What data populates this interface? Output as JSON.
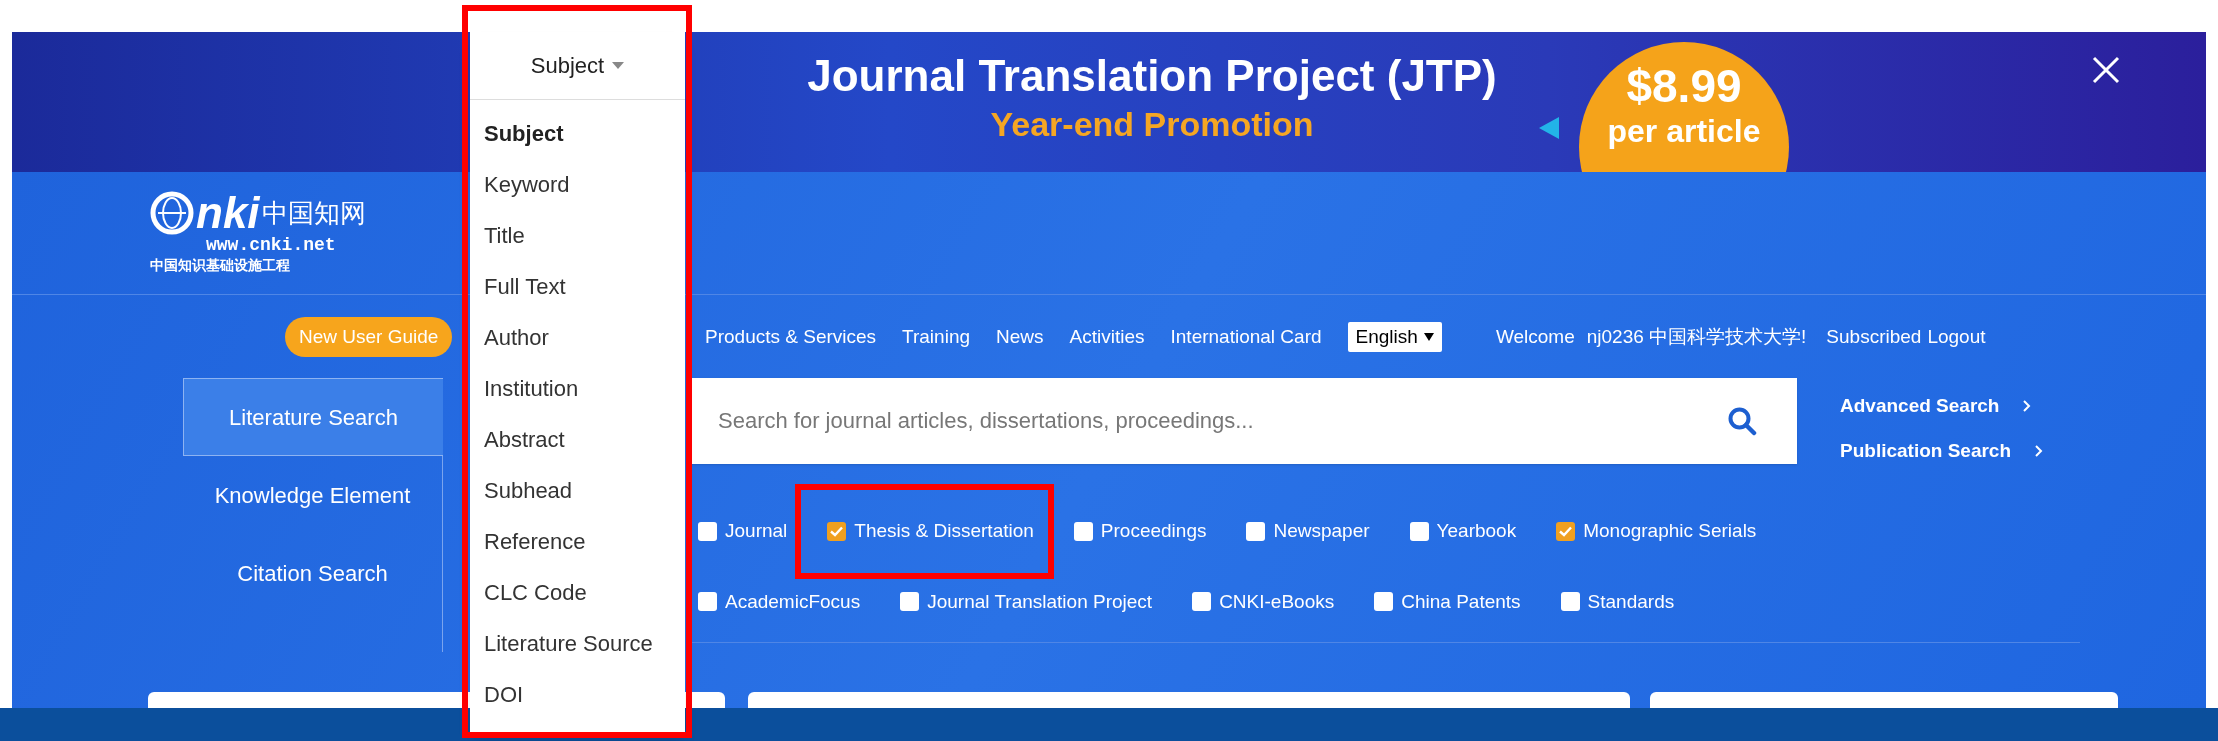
{
  "banner": {
    "title": "Journal Translation Project (JTP)",
    "subtitle": "Year-end Promotion",
    "price": "$8.99",
    "price_note": "per article"
  },
  "logo": {
    "wordmark": "nki",
    "chinese": "中国知网",
    "url": "www.cnki.net",
    "tagline": "中国知识基础设施工程"
  },
  "nav": {
    "guide": "New User Guide",
    "links": [
      "Products & Services",
      "Training",
      "News",
      "Activities",
      "International Card"
    ],
    "language": "English",
    "welcome": "Welcome",
    "user": "nj0236 中国科学技术大学!",
    "subscribed": "Subscribed",
    "logout": "Logout"
  },
  "tabs": [
    {
      "label": "Literature Search",
      "selected": true
    },
    {
      "label": "Knowledge Element",
      "selected": false
    },
    {
      "label": "Citation Search",
      "selected": false
    }
  ],
  "field_select": {
    "value": "Subject",
    "options": [
      {
        "label": "Subject",
        "selected": true
      },
      {
        "label": "Keyword",
        "selected": false
      },
      {
        "label": "Title",
        "selected": false
      },
      {
        "label": "Full Text",
        "selected": false
      },
      {
        "label": "Author",
        "selected": false
      },
      {
        "label": "Institution",
        "selected": false
      },
      {
        "label": "Abstract",
        "selected": false
      },
      {
        "label": "Subhead",
        "selected": false
      },
      {
        "label": "Reference",
        "selected": false
      },
      {
        "label": "CLC Code",
        "selected": false
      },
      {
        "label": "Literature Source",
        "selected": false
      },
      {
        "label": "DOI",
        "selected": false
      }
    ]
  },
  "search": {
    "placeholder": "Search for journal articles, dissertations, proceedings..."
  },
  "side_links": [
    "Advanced Search",
    "Publication Search"
  ],
  "database_rows": [
    [
      {
        "label": "Journal",
        "checked": false,
        "highlighted": false
      },
      {
        "label": "Thesis & Dissertation",
        "checked": true,
        "highlighted": true
      },
      {
        "label": "Proceedings",
        "checked": false,
        "highlighted": false
      },
      {
        "label": "Newspaper",
        "checked": false,
        "highlighted": false
      },
      {
        "label": "Yearbook",
        "checked": false,
        "highlighted": false
      },
      {
        "label": "Monographic Serials",
        "checked": true,
        "highlighted": false
      }
    ],
    [
      {
        "label": "AcademicFocus",
        "checked": false,
        "highlighted": false
      },
      {
        "label": "Journal Translation Project",
        "checked": false,
        "highlighted": false
      },
      {
        "label": "CNKI-eBooks",
        "checked": false,
        "highlighted": false
      },
      {
        "label": "China Patents",
        "checked": false,
        "highlighted": false
      },
      {
        "label": "Standards",
        "checked": false,
        "highlighted": false
      }
    ]
  ]
}
